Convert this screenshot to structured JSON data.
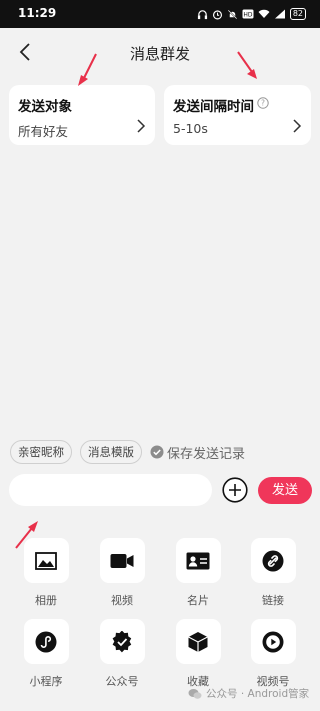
{
  "status_bar": {
    "time": "11:29",
    "battery": "82"
  },
  "header": {
    "title": "消息群发"
  },
  "cards": {
    "target": {
      "title": "发送对象",
      "value": "所有好友"
    },
    "interval": {
      "title": "发送间隔时间",
      "value": "5-10s"
    }
  },
  "tags": {
    "nickname": "亲密昵称",
    "template": "消息模版",
    "save_record": "保存发送记录"
  },
  "composer": {
    "placeholder": "",
    "send_label": "发送"
  },
  "panel": {
    "items": [
      {
        "label": "相册",
        "icon": "album-icon"
      },
      {
        "label": "视频",
        "icon": "video-icon"
      },
      {
        "label": "名片",
        "icon": "contact-card-icon"
      },
      {
        "label": "链接",
        "icon": "link-icon"
      },
      {
        "label": "小程序",
        "icon": "mini-program-icon"
      },
      {
        "label": "公众号",
        "icon": "official-account-icon"
      },
      {
        "label": "收藏",
        "icon": "favorites-icon"
      },
      {
        "label": "视频号",
        "icon": "channels-icon"
      }
    ]
  },
  "watermark": {
    "text": "公众号 · Android管家"
  },
  "colors": {
    "accent": "#f0365a",
    "background": "#f2f2f2",
    "annotation_arrow": "#e8304a"
  }
}
